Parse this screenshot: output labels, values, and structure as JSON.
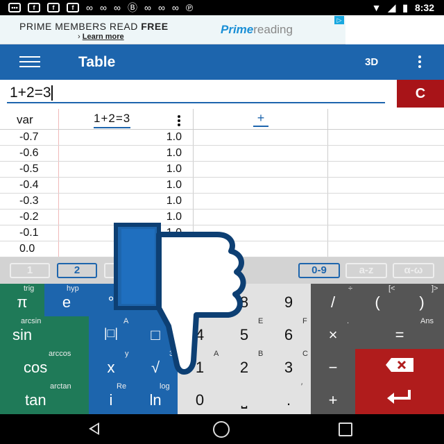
{
  "status_bar": {
    "time": "8:32"
  },
  "ad": {
    "line1_prefix": "PRIME MEMBERS READ ",
    "line1_bold": "FREE",
    "line2_prefix": "› ",
    "line2_link": "Learn more",
    "brand_a": "Prime",
    "brand_b": "reading"
  },
  "toolbar": {
    "title": "Table",
    "view_3d": "3D"
  },
  "input": {
    "expression": "1+2=3",
    "clear_label": "C"
  },
  "table": {
    "header_var": "var",
    "header_function": "1+2=3",
    "add_column": "+",
    "rows": [
      {
        "x": "-0.7",
        "y": "1.0"
      },
      {
        "x": "-0.6",
        "y": "1.0"
      },
      {
        "x": "-0.5",
        "y": "1.0"
      },
      {
        "x": "-0.4",
        "y": "1.0"
      },
      {
        "x": "-0.3",
        "y": "1.0"
      },
      {
        "x": "-0.2",
        "y": "1.0"
      },
      {
        "x": "-0.1",
        "y": "1.0"
      },
      {
        "x": "0.0",
        "y": ""
      }
    ]
  },
  "keyboard_tabs": [
    "1",
    "2",
    "0-9",
    "a-z",
    "α-ω"
  ],
  "keys": {
    "pi": "π",
    "e": "e",
    "deg": "°",
    "k8": "8",
    "k9": "9",
    "div": "/",
    "lparen": "(",
    "rparen": ")",
    "sin": "sin",
    "abs": "|□|",
    "pow": "□",
    "k4": "4",
    "k5": "5",
    "k6": "6",
    "mul": "×",
    "eq": "=",
    "cos": "cos",
    "x": "x",
    "sqrt": "√",
    "k1": "1",
    "k2": "2",
    "k3": "3",
    "minus": "−",
    "tan": "tan",
    "i": "i",
    "ln": "ln",
    "k0": "0",
    "space": "⎵",
    "dot": ".",
    "plus": "+",
    "sup_trig": "trig",
    "sup_hyp": "hyp",
    "sup_arcsin": "arcsin",
    "sup_arccos": "arccos",
    "sup_arctan": "arctan",
    "sup_A": "A",
    "sup_y": "y",
    "sup_Re": "Re",
    "sup_3": "3",
    "sup_log": "log",
    "sup_E": "E",
    "sup_F": "F",
    "sup_A2": "A",
    "sup_B": "B",
    "sup_C": "C",
    "sup_div": "÷",
    "sup_lt": "[<",
    "sup_gt": "]>",
    "sup_dot": ".",
    "sup_ans": "Ans",
    "sup_prime": "′"
  }
}
